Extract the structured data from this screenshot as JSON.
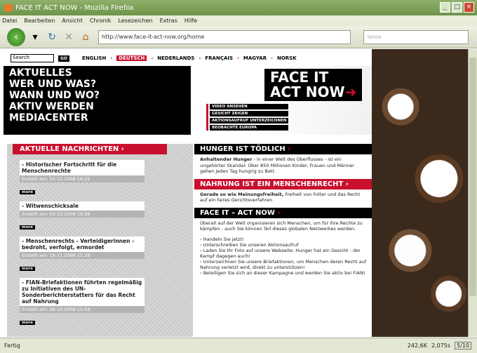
{
  "browser": {
    "title": "FACE IT ACT NOW - Mozilla Firefox",
    "menu": [
      "Datei",
      "Bearbeiten",
      "Ansicht",
      "Chronik",
      "Lesezeichen",
      "Extras",
      "Hilfe"
    ],
    "url": "http://www.face-it-act-now.org/home",
    "search_placeholder": "Yahoo",
    "status": "Fertig",
    "status_right": [
      "242,6K",
      "2,075s",
      "5/10"
    ]
  },
  "page": {
    "search_value": "Search",
    "go_label": "GO",
    "languages": [
      "ENGLISH",
      "DEUTSCH",
      "NEDERLANDS",
      "FRANÇAIS",
      "MAGYAR",
      "NORSK"
    ],
    "hero_nav": [
      "AKTUELLES",
      "WER UND WAS?",
      "WANN UND WO?",
      "AKTIV WERDEN",
      "MEDIACENTER"
    ],
    "logo": [
      "FACE IT",
      "ACT NOW"
    ],
    "hero_links": [
      "VIDEO ANSEHEN",
      "GESICHT ZEIGEN",
      "AKTIONSAUFRUF UNTERZEICHNEN",
      "BEOBACHTE EUROPA"
    ],
    "news_heading": "AKTUELLE NACHRICHTEN",
    "news": [
      {
        "title": "- Historischer Fortschritt für die Menschenrechte",
        "date": "Erstellt am: 15.12.2008 14:22"
      },
      {
        "title": "- Witwenschicksale",
        "date": "Erstellt am: 03.12.2008 19:26"
      },
      {
        "title": "- Menschenrechts - Verteidigerinnen - bedroht, verfolgt, ermordet",
        "date": "Erstellt am: 19.11.2008 11:38"
      },
      {
        "title": "- FIAN-Briefaktionen führten regelmäßig zu Initiativen des UN-Sonderberichterstatters für das Recht auf Nahrung",
        "date": "Erstellt am: 26.10.2008 15:54"
      }
    ],
    "more_label": "more",
    "sections": [
      {
        "heading": "HUNGER IST TÖDLICH",
        "bold": "Anhaltender Hunger",
        "text": " - in einer Welt des Überflusses - ist ein ungehörter Skandal: Über 850 Millionen Kinder, Frauen und Männer gehen jeden Tag hungrig zu Bett."
      },
      {
        "heading": "NAHRUNG IST EIN MENSCHENRECHT",
        "bold": "Gerade so wie Meinungsfreiheit,",
        "text": " Freiheit von Folter und das Recht auf ein faires Gerichtsverfahren"
      },
      {
        "heading": "FACE IT – ACT NOW",
        "bold": "",
        "text": "Überall auf der Welt organisieren sich Menschen, um für ihre Rechte zu kämpfen - auch Sie können Teil dieses globalen Netzwerkes werden."
      }
    ],
    "actions": [
      "Handeln Sie jetzt!",
      "Unterschreiben Sie unseren Aktionsaufruf",
      "Laden Sie Ihr Foto auf unsere Webseite: Hunger hat ein Gesicht - der Kampf dagegen auch!",
      "Unterzeichnen Sie unsere Briefaktionen, um Menschen deren Recht auf Nahrung verletzt wird, direkt zu unterstützen!",
      "Beteiligen Sie sich an dieser Kampagne und werden Sie aktiv bei FIAN!"
    ]
  }
}
